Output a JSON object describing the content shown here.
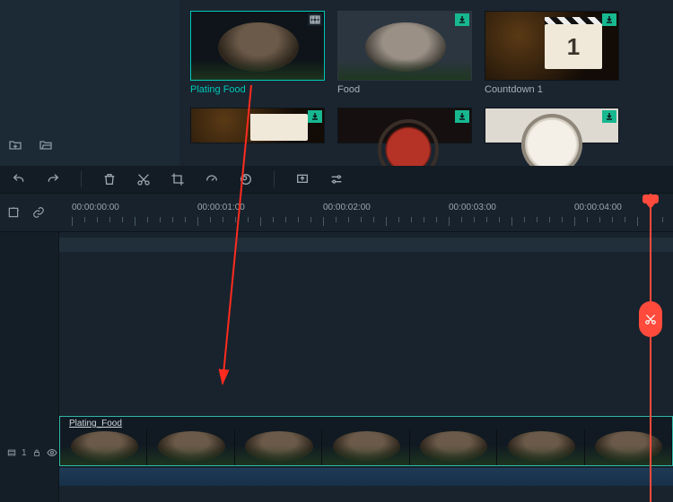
{
  "media": {
    "items_row1": [
      {
        "label": "Plating Food",
        "selected": true,
        "badge": "film"
      },
      {
        "label": "Food",
        "selected": false,
        "badge": "download"
      },
      {
        "label": "Countdown 1",
        "selected": false,
        "badge": "download",
        "big_number": "1"
      }
    ],
    "items_row2": [
      {
        "label": "",
        "badge": "download",
        "kind": "clap"
      },
      {
        "label": "",
        "badge": "download",
        "kind": "red-circle"
      },
      {
        "label": "",
        "badge": "download",
        "kind": "white-circle"
      }
    ]
  },
  "ruler": {
    "labels": [
      "00:00:00:00",
      "00:00:01:00",
      "00:00:02:00",
      "00:00:03:00",
      "00:00:04:00"
    ]
  },
  "timeline": {
    "clip_label": "Plating_Food",
    "track_badge": "1"
  },
  "icons": {
    "undo": "undo-icon",
    "redo": "redo-icon",
    "delete": "delete-icon",
    "cut": "cut-icon",
    "crop": "crop-icon",
    "speed": "speed-icon",
    "color": "color-icon",
    "export": "export-icon",
    "settings": "settings-icon"
  },
  "accent": "#00c9b7",
  "danger": "#ff4a3c"
}
